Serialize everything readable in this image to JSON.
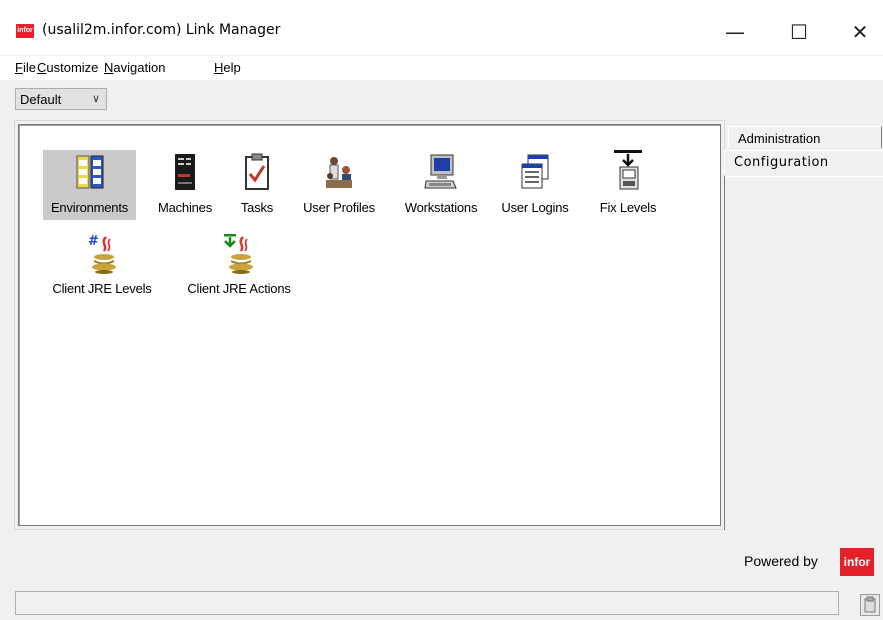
{
  "window": {
    "title": "(usalil2m.infor.com) Link Manager",
    "logo_text": "infor",
    "minimize_glyph": "—",
    "maximize_glyph": "☐",
    "close_glyph": "✕"
  },
  "menu": [
    {
      "label": "File",
      "accel": "F"
    },
    {
      "label": "Customize",
      "accel": "C"
    },
    {
      "label": "Navigation",
      "accel": "N"
    },
    {
      "label": "Help",
      "accel": "H"
    }
  ],
  "view_selector": {
    "value": "Default",
    "chevron": "∨"
  },
  "icons": [
    {
      "label": "Environments",
      "icon": "environments-icon",
      "selected": true
    },
    {
      "label": "Machines",
      "icon": "machines-icon"
    },
    {
      "label": "Tasks",
      "icon": "tasks-icon"
    },
    {
      "label": "User Profiles",
      "icon": "user-profiles-icon"
    },
    {
      "label": "Workstations",
      "icon": "workstations-icon"
    },
    {
      "label": "User Logins",
      "icon": "user-logins-icon"
    },
    {
      "label": "Fix Levels",
      "icon": "fix-levels-icon"
    },
    {
      "label": "Client JRE Levels",
      "icon": "client-jre-levels-icon"
    },
    {
      "label": "Client JRE Actions",
      "icon": "client-jre-actions-icon"
    }
  ],
  "tabs": [
    {
      "label": "Administration",
      "active": false
    },
    {
      "label": "Configuration",
      "active": true
    }
  ],
  "footer": {
    "powered_by": "Powered by",
    "brand": "infor"
  },
  "colors": {
    "brand": "#e4212a",
    "selection": "#c9c9c9"
  }
}
